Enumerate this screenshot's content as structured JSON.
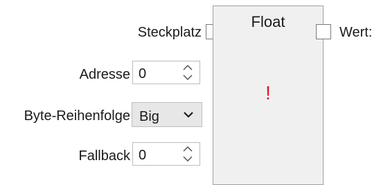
{
  "node": {
    "title": "Float",
    "error_indicator": "!",
    "error_color": "#e81123"
  },
  "inputs": {
    "slot_label": "Steckplatz",
    "address": {
      "label": "Adresse",
      "value": "0"
    },
    "byte_order": {
      "label": "Byte-Reihenfolge",
      "value": "Big"
    },
    "fallback": {
      "label": "Fallback",
      "value": "0"
    }
  },
  "outputs": {
    "value_label": "Wert:"
  },
  "icons": {
    "spin_up": "chevron-up-icon",
    "spin_down": "chevron-down-icon",
    "combo_arrow": "chevron-down-icon"
  }
}
